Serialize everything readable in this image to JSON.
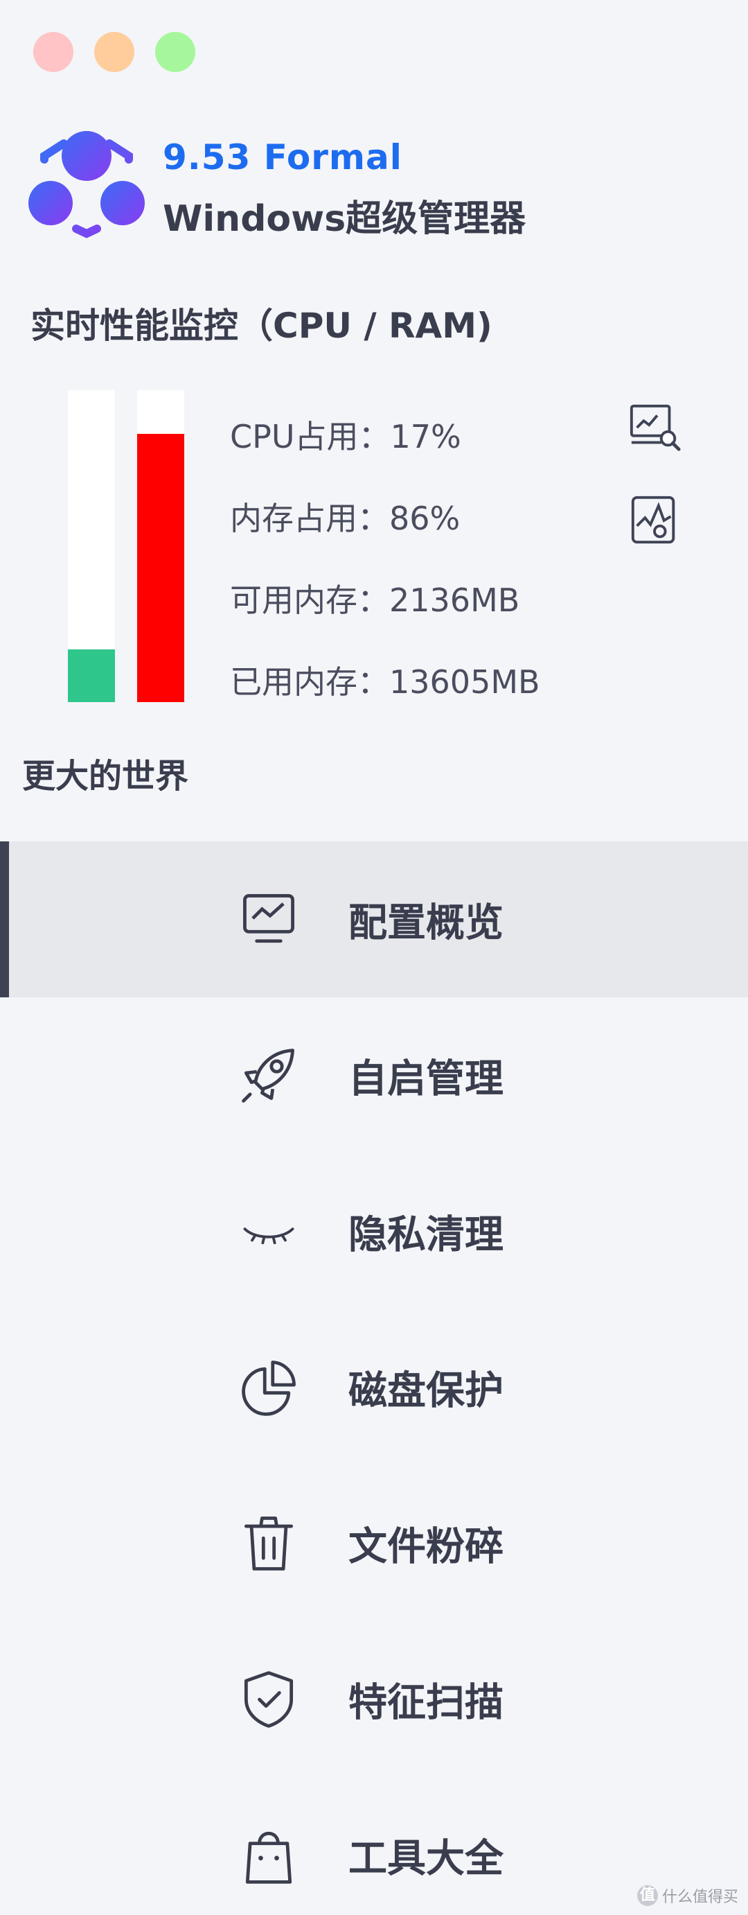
{
  "window": {
    "controls": [
      {
        "name": "close",
        "color": "#ffc4c5"
      },
      {
        "name": "minimize",
        "color": "#ffcc9c"
      },
      {
        "name": "maximize",
        "color": "#a6f79b"
      }
    ]
  },
  "brand": {
    "version": "9.53 Formal",
    "name": "Windows超级管理器",
    "version_color": "#1d6cf0",
    "logo_icon": "molecule-logo"
  },
  "monitor": {
    "title": "实时性能监控（CPU / RAM)",
    "cpu": {
      "label": "CPU占用：17%",
      "percent": 17,
      "color": "#2ec68b"
    },
    "ram": {
      "label": "内存占用：86%",
      "percent": 86,
      "color": "#ff0000"
    },
    "available": {
      "label": "可用内存：2136MB"
    },
    "used": {
      "label": "已用内存：13605MB"
    },
    "icons": [
      "monitor-search-icon",
      "chart-file-icon"
    ]
  },
  "world_link": "更大的世界",
  "nav": {
    "items": [
      {
        "id": "overview",
        "label": "配置概览",
        "icon": "monitor-chart-icon",
        "active": true
      },
      {
        "id": "startup",
        "label": "自启管理",
        "icon": "rocket-icon",
        "active": false
      },
      {
        "id": "privacy",
        "label": "隐私清理",
        "icon": "closed-eye-icon",
        "active": false
      },
      {
        "id": "disk",
        "label": "磁盘保护",
        "icon": "pie-chart-icon",
        "active": false
      },
      {
        "id": "shred",
        "label": "文件粉碎",
        "icon": "trash-icon",
        "active": false
      },
      {
        "id": "scan",
        "label": "特征扫描",
        "icon": "shield-check-icon",
        "active": false
      },
      {
        "id": "tools",
        "label": "工具大全",
        "icon": "shopping-bag-icon",
        "active": false
      }
    ]
  },
  "watermark": {
    "badge": "值",
    "text": "什么值得买"
  }
}
